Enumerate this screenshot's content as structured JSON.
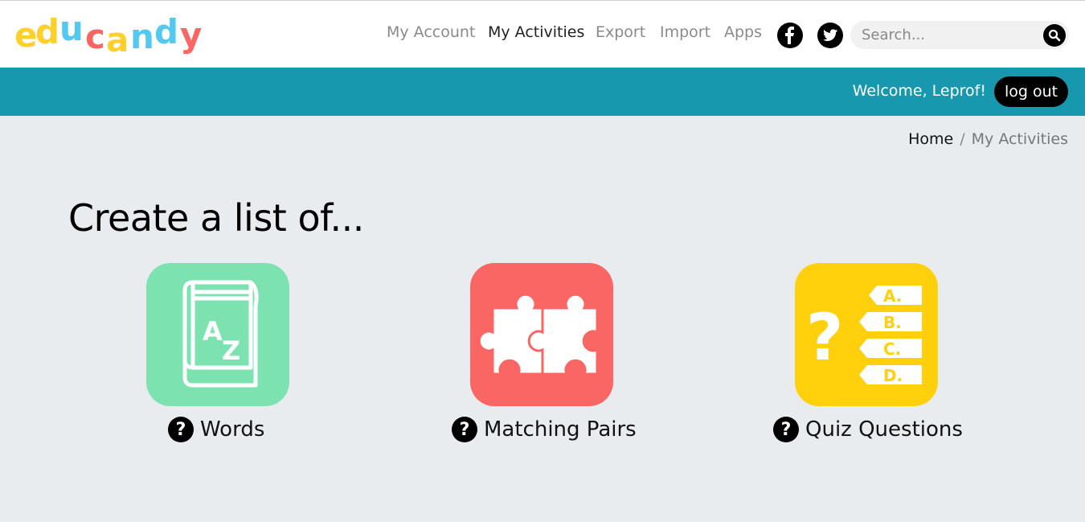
{
  "brand": {
    "logo_letters": [
      "e",
      "d",
      "u",
      "c",
      "a",
      "n",
      "d",
      "y"
    ],
    "logo_colors": [
      "#ffd02b",
      "#ffd02b",
      "#53c9f0",
      "#f96664",
      "#ffd02b",
      "#53c9f0",
      "#53c9f0",
      "#f96664"
    ]
  },
  "nav": {
    "items": [
      {
        "label": "My Account",
        "active": false
      },
      {
        "label": "My Activities",
        "active": true
      },
      {
        "label": "Export",
        "active": false
      },
      {
        "label": "Import",
        "active": false
      },
      {
        "label": "Apps",
        "active": false
      }
    ],
    "social": [
      "facebook-icon",
      "twitter-icon"
    ]
  },
  "search": {
    "placeholder": "Search..."
  },
  "welcome": {
    "text": "Welcome, Leprof!",
    "logout_label": "log out"
  },
  "breadcrumb": {
    "home": "Home",
    "separator": "/",
    "current": "My Activities"
  },
  "main": {
    "heading": "Create a list of...",
    "cards": [
      {
        "label": "Words",
        "color": "#7ce3b0",
        "icon": "book-az-icon"
      },
      {
        "label": "Matching Pairs",
        "color": "#f96664",
        "icon": "puzzle-icon"
      },
      {
        "label": "Quiz Questions",
        "color": "#ffd00b",
        "icon": "quiz-abcd-icon"
      }
    ],
    "help_glyph": "?",
    "quiz_options": [
      "A.",
      "B.",
      "C.",
      "D."
    ],
    "book_text": [
      "A",
      "Z"
    ]
  },
  "colors": {
    "header_bar": "#1798ae",
    "background": "#e9ecef"
  }
}
